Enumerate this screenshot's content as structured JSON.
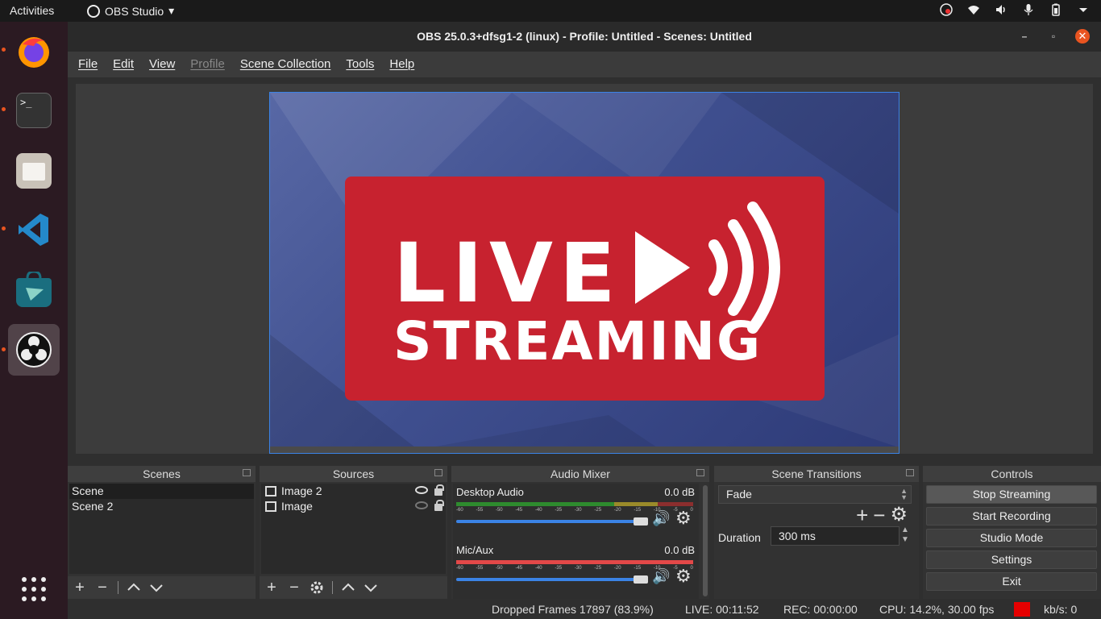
{
  "topbar": {
    "activities": "Activities",
    "app_name": "OBS Studio",
    "app_menu_arrow": "▾"
  },
  "dock": {
    "items": [
      {
        "name": "firefox",
        "running": true
      },
      {
        "name": "terminal",
        "running": true,
        "glyph": ">_"
      },
      {
        "name": "files",
        "running": false
      },
      {
        "name": "vscode",
        "running": true
      },
      {
        "name": "software",
        "running": false
      },
      {
        "name": "obs",
        "running": true,
        "active": true
      }
    ],
    "show_apps_icon": "app-grid-icon"
  },
  "window": {
    "title": "OBS 25.0.3+dfsg1-2 (linux) - Profile: Untitled - Scenes: Untitled",
    "controls": {
      "minimize": "–",
      "maximize": "▫",
      "close": "✕"
    }
  },
  "menu": [
    "File",
    "Edit",
    "View",
    "Profile",
    "Scene Collection",
    "Tools",
    "Help"
  ],
  "menu_disabled": [
    "Profile"
  ],
  "preview": {
    "line1": "LIVE",
    "line2": "STREAMING",
    "card_color": "#c7222f",
    "background_color": "#4a5a92"
  },
  "scenes": {
    "title": "Scenes",
    "items": [
      "Scene",
      "Scene 2"
    ],
    "selected": "Scene"
  },
  "sources": {
    "title": "Sources",
    "items": [
      {
        "label": "Image 2",
        "visible": true,
        "locked": true
      },
      {
        "label": "Image",
        "visible": false,
        "locked": true
      }
    ]
  },
  "mixer": {
    "title": "Audio Mixer",
    "channels": [
      {
        "name": "Desktop Audio",
        "db": "0.0 dB",
        "meter_color": "green"
      },
      {
        "name": "Mic/Aux",
        "db": "0.0 dB",
        "meter_color": "red"
      }
    ],
    "scale": [
      "-60",
      "-55",
      "-50",
      "-45",
      "-40",
      "-35",
      "-30",
      "-25",
      "-20",
      "-15",
      "-10",
      "-5",
      "0"
    ]
  },
  "transitions": {
    "title": "Scene Transitions",
    "selected": "Fade",
    "duration_label": "Duration",
    "duration_value": "300 ms"
  },
  "controls": {
    "title": "Controls",
    "buttons": [
      "Stop Streaming",
      "Start Recording",
      "Studio Mode",
      "Settings",
      "Exit"
    ],
    "pressed": "Stop Streaming"
  },
  "status": {
    "dropped": "Dropped Frames 17897 (83.9%)",
    "live": "LIVE: 00:11:52",
    "rec": "REC: 00:00:00",
    "cpu": "CPU: 14.2%, 30.00 fps",
    "kbps": "kb/s: 0",
    "indicator_color": "#e60000"
  }
}
